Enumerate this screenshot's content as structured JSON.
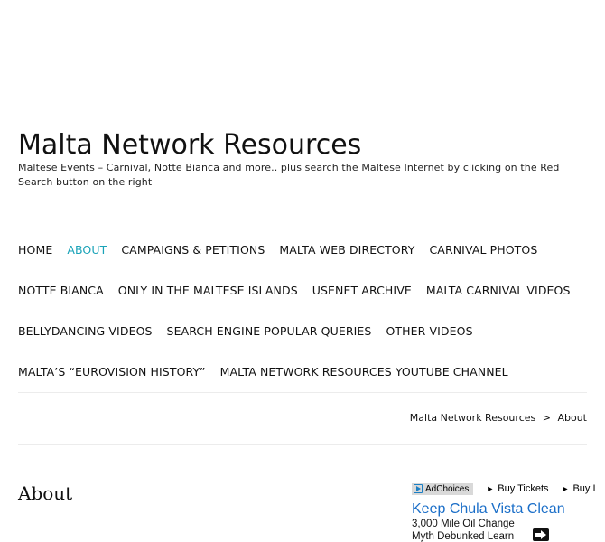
{
  "header": {
    "site_title": "Malta Network Resources",
    "site_description": "Maltese Events – Carnival, Notte Bianca and more.. plus search the Maltese Internet by clicking on the Red Search button on the right"
  },
  "nav": {
    "rows": [
      [
        {
          "label": "HOME",
          "active": false
        },
        {
          "label": "ABOUT",
          "active": true
        },
        {
          "label": "CAMPAIGNS & PETITIONS",
          "active": false
        },
        {
          "label": "MALTA WEB DIRECTORY",
          "active": false
        },
        {
          "label": "CARNIVAL PHOTOS",
          "active": false
        }
      ],
      [
        {
          "label": "NOTTE BIANCA",
          "active": false
        },
        {
          "label": "ONLY IN THE MALTESE ISLANDS",
          "active": false
        },
        {
          "label": "USENET ARCHIVE",
          "active": false
        },
        {
          "label": "MALTA CARNIVAL VIDEOS",
          "active": false
        }
      ],
      [
        {
          "label": "BELLYDANCING VIDEOS",
          "active": false
        },
        {
          "label": "SEARCH ENGINE POPULAR QUERIES",
          "active": false
        },
        {
          "label": "OTHER VIDEOS",
          "active": false
        }
      ],
      [
        {
          "label": "MALTA’S “EUROVISION HISTORY”",
          "active": false
        },
        {
          "label": "MALTA NETWORK RESOURCES YOUTUBE CHANNEL",
          "active": false
        }
      ]
    ],
    "active_color": "#1aa3b8"
  },
  "breadcrumb": {
    "home": "Malta Network Resources",
    "separator": ">",
    "current": "About"
  },
  "page": {
    "title": "About"
  },
  "ad": {
    "adchoices_label": "AdChoices",
    "adchoices_icon": "adchoices-icon",
    "links": [
      "Buy Tickets",
      "Buy I"
    ],
    "headline": "Keep Chula Vista Clean",
    "body": "3,000 Mile Oil Change Myth Debunked Learn",
    "arrow_icon": "arrow-right-icon",
    "headline_color": "#1a6ec8"
  }
}
